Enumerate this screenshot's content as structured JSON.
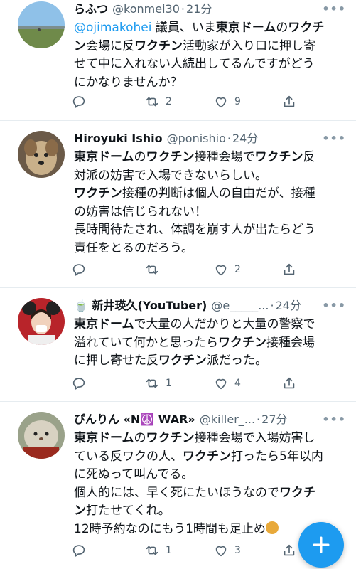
{
  "tweets": [
    {
      "name": "らふつ",
      "handle": "@konmei30",
      "sep": "·",
      "time": "21分",
      "lines": [
        [
          {
            "t": "@ojimakohei",
            "s": "mention"
          },
          {
            "t": " 議員、いま",
            "s": ""
          },
          {
            "t": "東京ドーム",
            "s": "b"
          },
          {
            "t": "の",
            "s": ""
          },
          {
            "t": "ワクチ",
            "s": "b"
          }
        ],
        [
          {
            "t": "ン",
            "s": "b"
          },
          {
            "t": "会場に反",
            "s": ""
          },
          {
            "t": "ワクチン",
            "s": "b"
          },
          {
            "t": "活動家が入り口に押し寄",
            "s": ""
          }
        ],
        [
          {
            "t": "せて中に入れない人続出してるんですがどう",
            "s": ""
          }
        ],
        [
          {
            "t": "にかなりませんか？",
            "s": ""
          }
        ]
      ],
      "replies": "",
      "retweets": "2",
      "likes": "9"
    },
    {
      "name": "Hiroyuki Ishio",
      "handle": "@ponishio",
      "sep": "·",
      "time": "24分",
      "lines": [
        [
          {
            "t": "東京ドーム",
            "s": "b"
          },
          {
            "t": "の",
            "s": ""
          },
          {
            "t": "ワクチン",
            "s": "b"
          },
          {
            "t": "接種会場で",
            "s": ""
          },
          {
            "t": "ワクチン",
            "s": "b"
          },
          {
            "t": "反",
            "s": ""
          }
        ],
        [
          {
            "t": "対派の妨害で入場できないらしい。",
            "s": ""
          }
        ],
        [
          {
            "t": "ワクチン",
            "s": "b"
          },
          {
            "t": "接種の判断は個人の自由だが、接種",
            "s": ""
          }
        ],
        [
          {
            "t": "の妨害は信じられない！",
            "s": ""
          }
        ],
        [
          {
            "t": "長時間待たされ、体調を崩す人が出たらどう",
            "s": ""
          }
        ],
        [
          {
            "t": "責任をとるのだろう。",
            "s": ""
          }
        ]
      ],
      "replies": "",
      "retweets": "",
      "likes": "2"
    },
    {
      "name": "🍵 新井瑛久(YouTuber)",
      "handle": "@e_____...",
      "sep": "·",
      "time": "24分",
      "lines": [
        [
          {
            "t": "東京ドーム",
            "s": "b"
          },
          {
            "t": "で大量の人だかりと大量の警察で",
            "s": ""
          }
        ],
        [
          {
            "t": "溢れていて何かと思ったら",
            "s": ""
          },
          {
            "t": "ワクチン",
            "s": "b"
          },
          {
            "t": "接種会場",
            "s": ""
          }
        ],
        [
          {
            "t": "に押し寄せた反",
            "s": ""
          },
          {
            "t": "ワクチン",
            "s": "b"
          },
          {
            "t": "派だった。",
            "s": ""
          }
        ]
      ],
      "replies": "",
      "retweets": "1",
      "likes": "4"
    },
    {
      "name": "ぴんりん «N☮️ WAR»",
      "handle": "@killer_...",
      "sep": "·",
      "time": "27分",
      "lines": [
        [
          {
            "t": "東京ドーム",
            "s": "b"
          },
          {
            "t": "の",
            "s": ""
          },
          {
            "t": "ワクチン",
            "s": "b"
          },
          {
            "t": "接種会場で入場妨害し",
            "s": ""
          }
        ],
        [
          {
            "t": "ている反ワクの人、",
            "s": ""
          },
          {
            "t": "ワクチン",
            "s": "b"
          },
          {
            "t": "打ったら5年以内",
            "s": ""
          }
        ],
        [
          {
            "t": "に死ぬって叫んでる。",
            "s": ""
          }
        ],
        [
          {
            "t": "個人的には、早く死にたいほうなので",
            "s": ""
          },
          {
            "t": "ワクチ",
            "s": "b"
          }
        ],
        [
          {
            "t": "ン",
            "s": "b"
          },
          {
            "t": "打たせてくれ。",
            "s": ""
          }
        ],
        [
          {
            "t": "12時予約なのにもう1時間も足止め",
            "s": ""
          }
        ]
      ],
      "replies": "",
      "retweets": "1",
      "likes": "3"
    }
  ],
  "icons": {
    "reply": "reply-icon",
    "retweet": "retweet-icon",
    "like": "heart-icon",
    "share": "share-icon",
    "more": "more-icon",
    "compose": "compose-plus-icon"
  },
  "colors": {
    "mention": "#1d9bf0",
    "fab": "#1d9bf0",
    "secondary": "#536471"
  }
}
